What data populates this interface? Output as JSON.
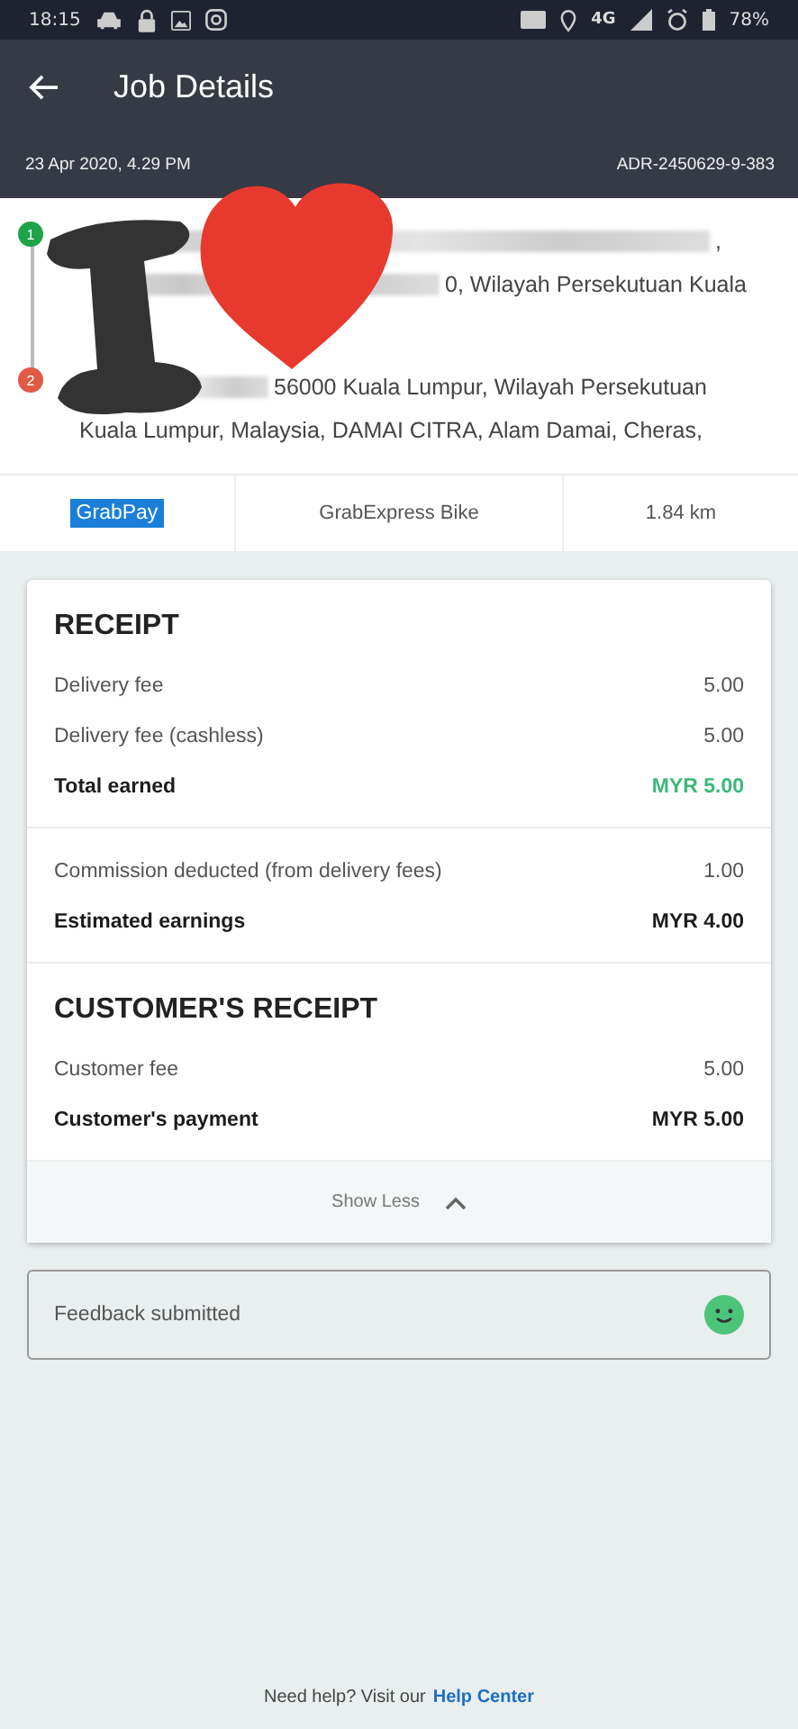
{
  "status_bar": {
    "time": "18:15",
    "battery": "78%",
    "network": "4G"
  },
  "header": {
    "title": "Job Details",
    "date": "23 Apr 2020, 4.29 PM",
    "job_id": "ADR-2450629-9-383"
  },
  "stops": [
    {
      "number": "1",
      "color": "#1fa34a",
      "lines": [
        {
          "redacted": true,
          "text": ","
        },
        {
          "redacted": true,
          "text": "0, Wilayah Persekutuan Kuala"
        }
      ]
    },
    {
      "number": "2",
      "color": "#e05a45",
      "lines": [
        {
          "redacted": true,
          "text": "56000 Kuala Lumpur, Wilayah Persekutuan"
        },
        {
          "redacted": false,
          "text": "Kuala Lumpur, Malaysia, DAMAI CITRA, Alam Damai, Cheras,"
        }
      ]
    }
  ],
  "info": {
    "payment": "GrabPay",
    "service": "GrabExpress Bike",
    "distance": "1.84 km"
  },
  "receipt": {
    "title": "RECEIPT",
    "sections": [
      {
        "rows": [
          {
            "label": "Delivery fee",
            "value": "5.00",
            "kind": "item"
          },
          {
            "label": "Delivery fee (cashless)",
            "value": "5.00",
            "kind": "item"
          },
          {
            "label": "Total earned",
            "value": "MYR 5.00",
            "kind": "total",
            "color": "#3cb878"
          }
        ]
      },
      {
        "rows": [
          {
            "label": "Commission deducted (from delivery fees)",
            "value": "1.00",
            "kind": "item"
          },
          {
            "label": "Estimated earnings",
            "value": "MYR 4.00",
            "kind": "total",
            "color": "#1c1c1c"
          }
        ]
      }
    ]
  },
  "customer_receipt": {
    "title": "CUSTOMER'S RECEIPT",
    "rows": [
      {
        "label": "Customer fee",
        "value": "5.00",
        "kind": "item"
      },
      {
        "label": "Customer's payment",
        "value": "MYR 5.00",
        "kind": "total",
        "color": "#1c1c1c"
      }
    ]
  },
  "toggle": {
    "label": "Show Less",
    "expanded": true
  },
  "feedback": {
    "label": "Feedback submitted"
  },
  "footer": {
    "text": "Need help? Visit our",
    "link": "Help Center"
  }
}
